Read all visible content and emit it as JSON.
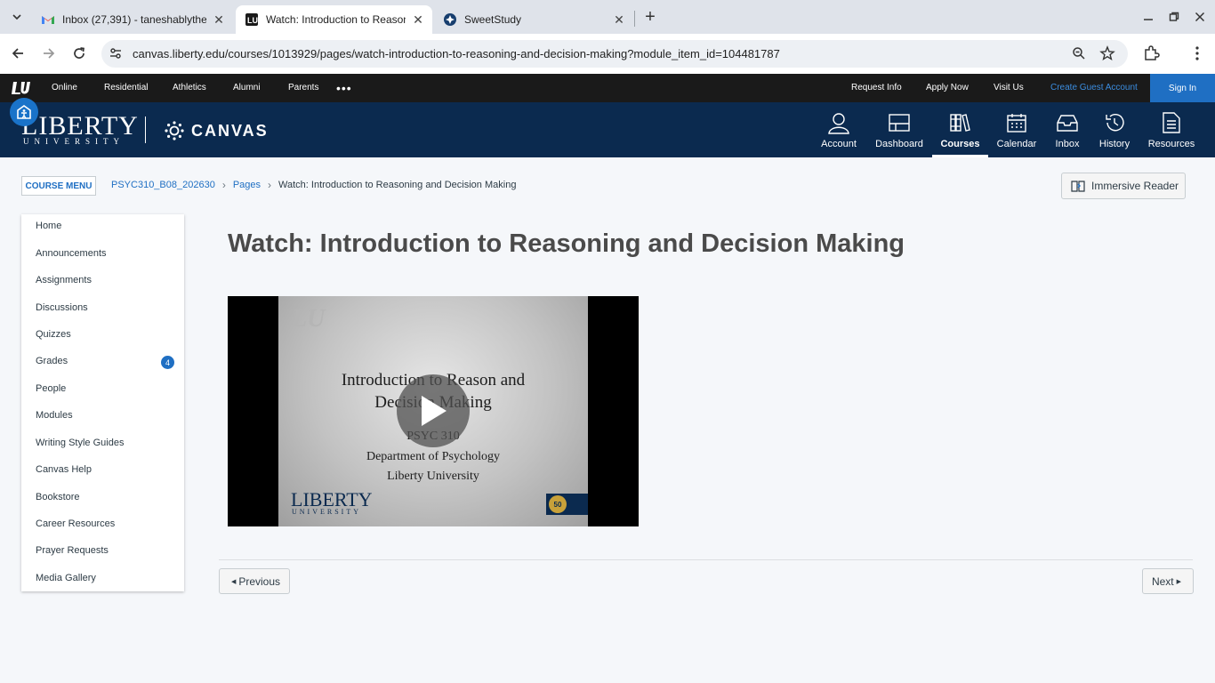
{
  "browser": {
    "tabs": [
      {
        "title": "Inbox (27,391) - taneshablythe",
        "favicon": "gmail-icon",
        "active": false
      },
      {
        "title": "Watch: Introduction to Reasoni",
        "favicon": "liberty-lu-icon",
        "active": true
      },
      {
        "title": "SweetStudy",
        "favicon": "sweetstudy-icon",
        "active": false
      }
    ],
    "url": "canvas.liberty.edu/courses/1013929/pages/watch-introduction-to-reasoning-and-decision-making?module_item_id=104481787"
  },
  "liberty_bar": {
    "left_links": [
      "Online",
      "Residential",
      "Athletics",
      "Alumni",
      "Parents"
    ],
    "more": "•••",
    "right_links": [
      "Request Info",
      "Apply Now",
      "Visit Us"
    ],
    "guest": "Create Guest Account",
    "signin": "Sign In"
  },
  "header": {
    "brand_liberty": "LIBERTY",
    "brand_university": "UNIVERSITY",
    "brand_canvas": "CANVAS",
    "global_nav": [
      {
        "label": "Account",
        "icon": "account-icon"
      },
      {
        "label": "Dashboard",
        "icon": "dashboard-icon"
      },
      {
        "label": "Courses",
        "icon": "courses-icon",
        "active": true
      },
      {
        "label": "Calendar",
        "icon": "calendar-icon"
      },
      {
        "label": "Inbox",
        "icon": "inbox-icon"
      },
      {
        "label": "History",
        "icon": "history-icon"
      },
      {
        "label": "Resources",
        "icon": "resources-icon"
      }
    ]
  },
  "breadcrumb": {
    "course_menu": "COURSE MENU",
    "items": [
      "PSYC310_B08_202630",
      "Pages",
      "Watch: Introduction to Reasoning and Decision Making"
    ],
    "immersive_reader": "Immersive Reader"
  },
  "course_nav": {
    "items": [
      {
        "label": "Home"
      },
      {
        "label": "Announcements"
      },
      {
        "label": "Assignments"
      },
      {
        "label": "Discussions"
      },
      {
        "label": "Quizzes"
      },
      {
        "label": "Grades",
        "badge": "4"
      },
      {
        "label": "People"
      },
      {
        "label": "Modules"
      },
      {
        "label": "Writing Style Guides"
      },
      {
        "label": "Canvas Help"
      },
      {
        "label": "Bookstore"
      },
      {
        "label": "Career Resources"
      },
      {
        "label": "Prayer Requests"
      },
      {
        "label": "Media Gallery"
      }
    ]
  },
  "content": {
    "title": "Watch: Introduction to Reasoning and Decision Making",
    "video_slide": {
      "watermark": "LU",
      "title_line1": "Introduction to Reason and",
      "title_line2": "Decision Making",
      "course": "PSYC 310",
      "department": "Department of Psychology",
      "university": "Liberty University",
      "logo_liberty": "LIBERTY",
      "logo_university": "UNIVERSITY",
      "seal": "50"
    },
    "previous": "Previous",
    "next": "Next"
  },
  "colors": {
    "header_navy": "#0b2a4f",
    "link_blue": "#1f6fc3",
    "signin_blue": "#1f6fc3"
  }
}
